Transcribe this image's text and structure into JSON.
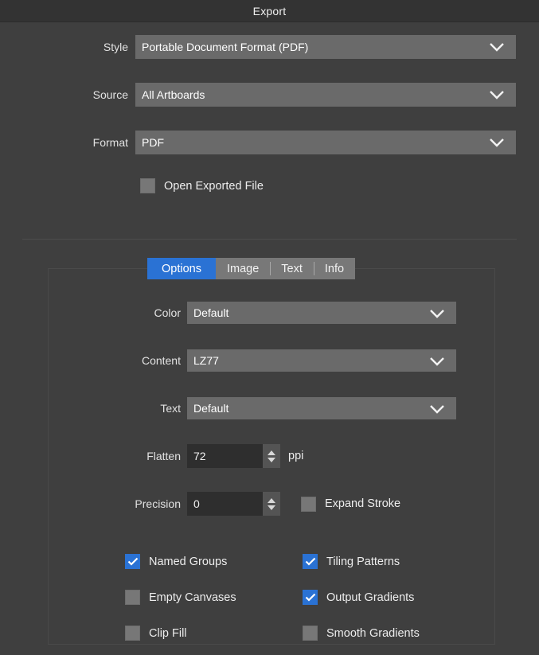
{
  "window": {
    "title": "Export"
  },
  "top_form": {
    "rows": [
      {
        "label": "Style",
        "value": "Portable Document Format (PDF)",
        "icon": "chevron-down-icon"
      },
      {
        "label": "Source",
        "value": "All Artboards",
        "icon": "chevron-down-icon"
      },
      {
        "label": "Format",
        "value": "PDF",
        "icon": "chevron-down-icon"
      }
    ],
    "open_exported_file": {
      "label": "Open Exported File",
      "checked": false
    }
  },
  "tabs": [
    {
      "label": "Options",
      "active": true
    },
    {
      "label": "Image",
      "active": false
    },
    {
      "label": "Text",
      "active": false
    },
    {
      "label": "Info",
      "active": false
    }
  ],
  "options_panel": {
    "selects": [
      {
        "label": "Color",
        "value": "Default",
        "icon": "chevron-down-icon"
      },
      {
        "label": "Content",
        "value": "LZ77",
        "icon": "chevron-down-icon"
      },
      {
        "label": "Text",
        "value": "Default",
        "icon": "chevron-down-icon"
      }
    ],
    "flatten": {
      "label": "Flatten",
      "value": "72",
      "unit": "ppi"
    },
    "precision": {
      "label": "Precision",
      "value": "0"
    },
    "expand_stroke": {
      "label": "Expand Stroke",
      "checked": false
    },
    "checkboxes": [
      {
        "label": "Named Groups",
        "checked": true
      },
      {
        "label": "Tiling Patterns",
        "checked": true
      },
      {
        "label": "Empty Canvases",
        "checked": false
      },
      {
        "label": "Output Gradients",
        "checked": true
      },
      {
        "label": "Clip Fill",
        "checked": false
      },
      {
        "label": "Smooth Gradients",
        "checked": false
      }
    ]
  },
  "colors": {
    "accent": "#2a72d4",
    "window_bg": "#3f3f3f",
    "titlebar_bg": "#333333",
    "field_bg": "#6a6a6a",
    "spinner_bg": "#2e2e2e"
  }
}
